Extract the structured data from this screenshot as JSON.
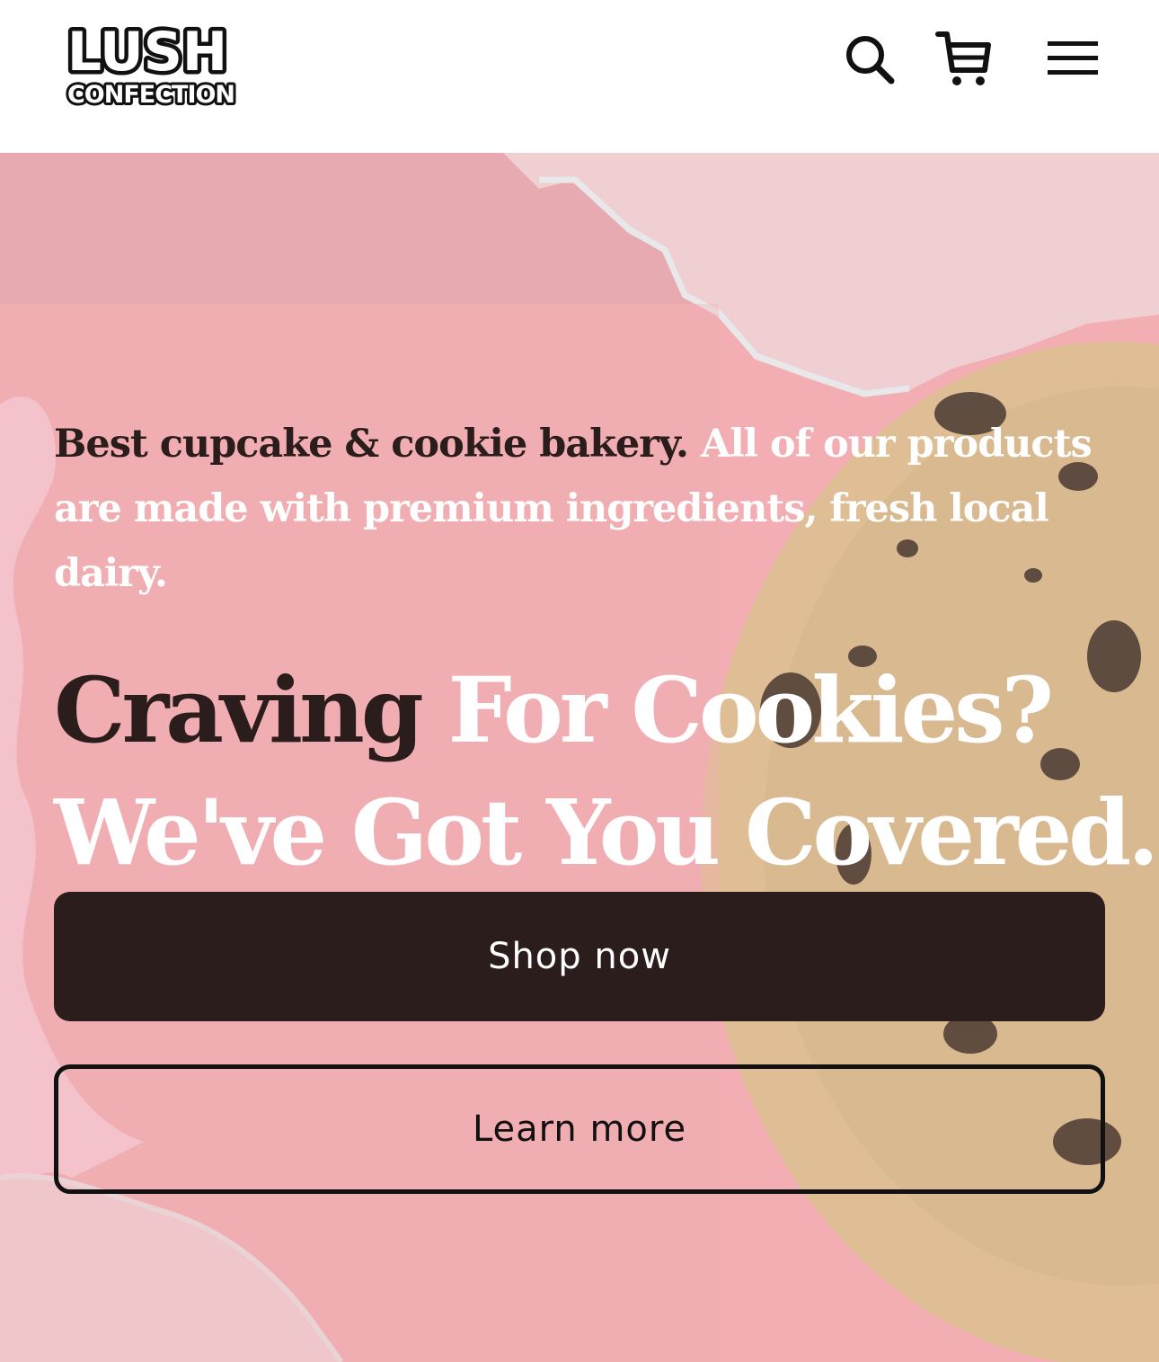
{
  "brand": {
    "logo_line1": "LUSH",
    "logo_line2": "CONFECTION"
  },
  "header": {
    "icons": [
      "search-icon",
      "cart-icon",
      "menu-icon"
    ]
  },
  "hero": {
    "tagline_dark": "Best cupcake & cookie bakery.",
    "tagline_light": "All of our products are made with premium ingredients, fresh local dairy.",
    "headline_dark": "Craving",
    "headline_light_1": "For Cookies?",
    "headline_light_2": "We've Got You Covered.",
    "primary_button": "Shop now",
    "secondary_button": "Learn more"
  },
  "colors": {
    "brand_dark": "#2c1d1d",
    "hero_pink": "#f2aeb3",
    "white": "#ffffff"
  }
}
